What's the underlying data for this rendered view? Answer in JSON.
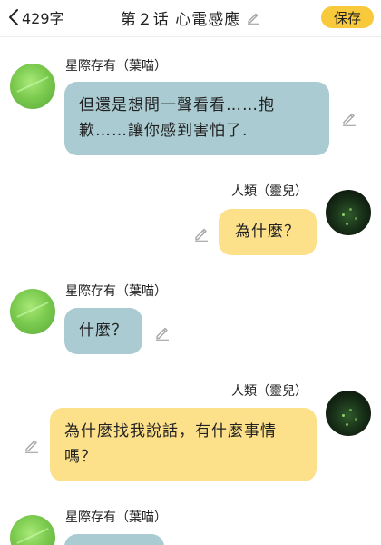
{
  "header": {
    "back_icon": "chevron-left-icon",
    "word_count": "429字",
    "title": "第２话 心電感應",
    "save_label": "保存"
  },
  "colors": {
    "save_button": "#f7c93b",
    "bubble_left": "#a9cbd1",
    "bubble_right": "#fde08a",
    "pencil_icon": "#a7a7a7"
  },
  "messages": [
    {
      "side": "left",
      "name": "星際存有（葉喵）",
      "text": "但還是想問一聲看看……抱歉……讓你感到害怕了."
    },
    {
      "side": "right",
      "name": "人類（靈兒）",
      "text": "為什麼？"
    },
    {
      "side": "left",
      "name": "星際存有（葉喵）",
      "text": "什麼？"
    },
    {
      "side": "right",
      "name": "人類（靈兒）",
      "text": "為什麼找我說話，有什麼事情嗎？"
    },
    {
      "side": "left",
      "name": "星際存有（葉喵）",
      "text": ""
    }
  ]
}
